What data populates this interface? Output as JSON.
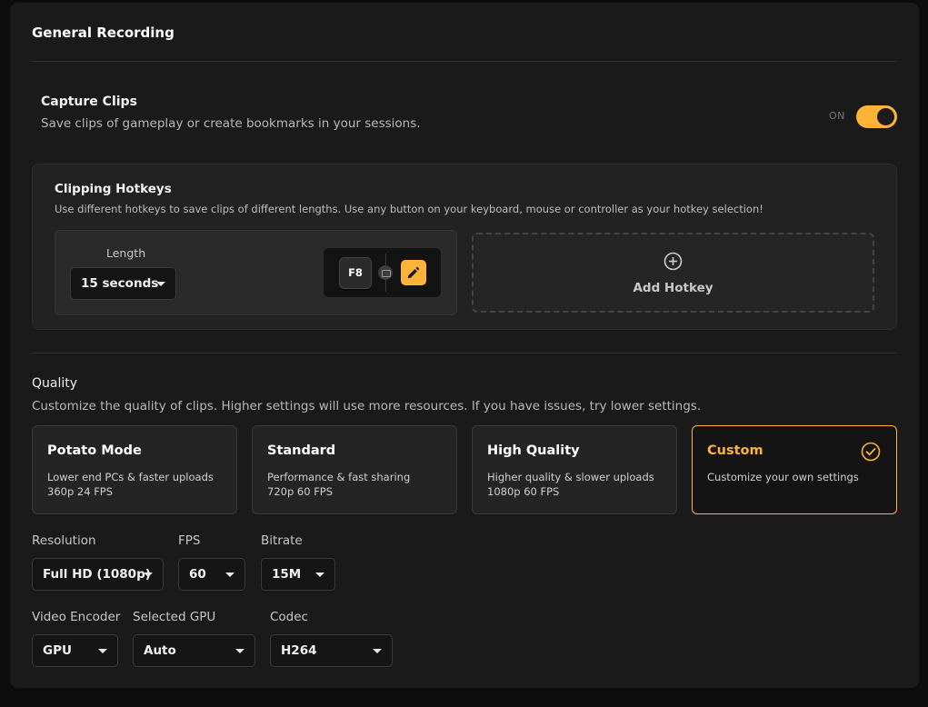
{
  "section_title": "General Recording",
  "capture": {
    "title": "Capture Clips",
    "description": "Save clips of gameplay or create bookmarks in your sessions.",
    "toggle_state": "ON",
    "enabled": true
  },
  "hotkeys": {
    "title": "Clipping Hotkeys",
    "description": "Use different hotkeys to save clips of different lengths. Use any button on your keyboard, mouse or controller as your hotkey selection!",
    "length_label": "Length",
    "length_value": "15 seconds",
    "key": "F8",
    "add_label": "Add Hotkey"
  },
  "quality": {
    "title": "Quality",
    "description": "Customize the quality of clips. Higher settings will use more resources. If you have issues, try lower settings.",
    "presets": [
      {
        "name": "Potato Mode",
        "desc": "Lower end PCs & faster uploads",
        "spec": "360p 24 FPS",
        "selected": false
      },
      {
        "name": "Standard",
        "desc": "Performance & fast sharing",
        "spec": "720p 60 FPS",
        "selected": false
      },
      {
        "name": "High Quality",
        "desc": "Higher quality & slower uploads",
        "spec": "1080p 60 FPS",
        "selected": false
      },
      {
        "name": "Custom",
        "desc": "Customize your own settings",
        "spec": "",
        "selected": true
      }
    ]
  },
  "settings": {
    "resolution": {
      "label": "Resolution",
      "value": "Full HD (1080p)"
    },
    "fps": {
      "label": "FPS",
      "value": "60"
    },
    "bitrate": {
      "label": "Bitrate",
      "value": "15M"
    },
    "encoder": {
      "label": "Video Encoder",
      "value": "GPU"
    },
    "gpu": {
      "label": "Selected GPU",
      "value": "Auto"
    },
    "codec": {
      "label": "Codec",
      "value": "H264"
    }
  },
  "colors": {
    "accent": "#ffb438",
    "panel": "#1a1a1a",
    "background": "#0d0d0d"
  },
  "icons": {
    "edit": "pencil-icon",
    "add": "plus-circle-icon",
    "selected": "check-circle-icon",
    "key_type": "keyboard-icon",
    "dropdown": "chevron-down-icon"
  }
}
